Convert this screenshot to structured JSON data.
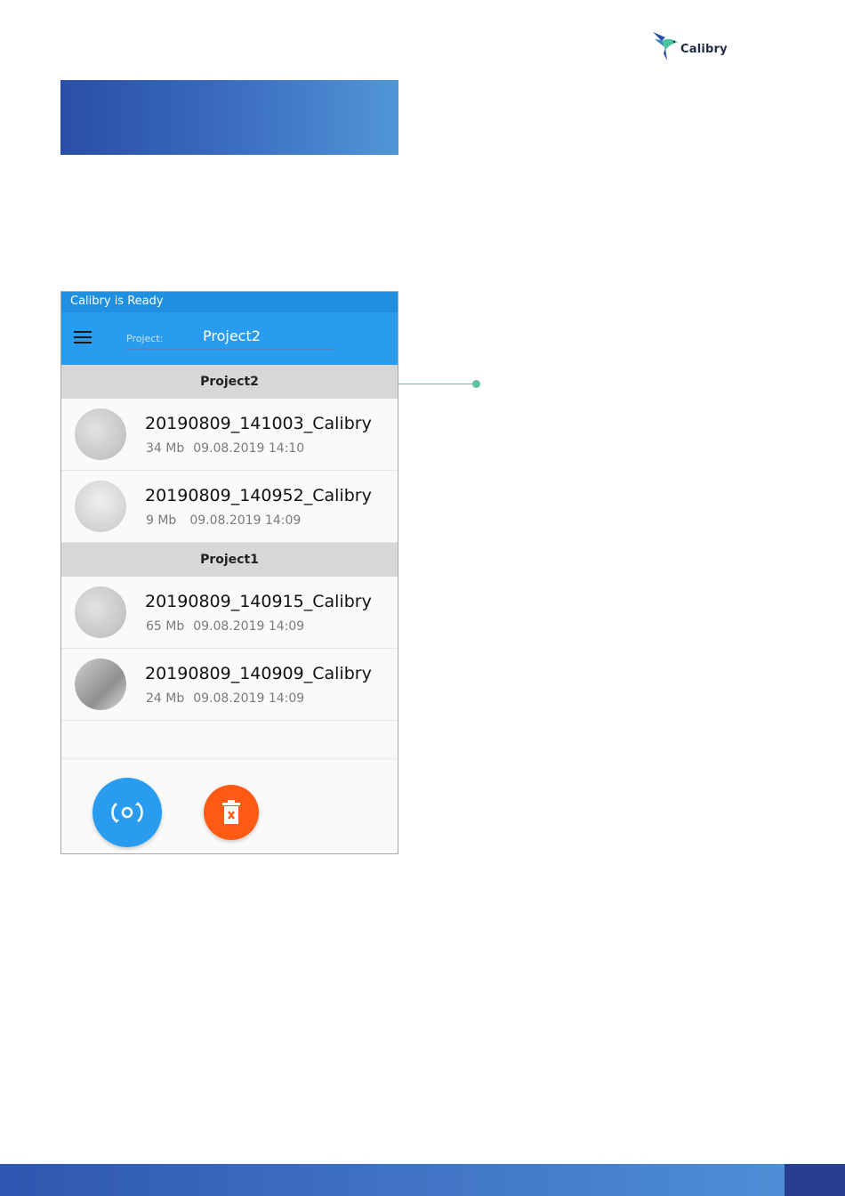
{
  "brand": {
    "logo_text": "Calibry"
  },
  "app": {
    "status_text": "Calibry is Ready",
    "project_label": "Project:",
    "project_value": "Project2"
  },
  "sections": [
    {
      "title": "Project2",
      "items": [
        {
          "name": "20190809_141003_Calibry",
          "size": "34 Mb",
          "date": "09.08.2019 14:10"
        },
        {
          "name": "20190809_140952_Calibry",
          "size": "9 Mb",
          "date": "09.08.2019 14:09"
        }
      ]
    },
    {
      "title": "Project1",
      "items": [
        {
          "name": "20190809_140915_Calibry",
          "size": "65 Mb",
          "date": "09.08.2019 14:09"
        },
        {
          "name": "20190809_140909_Calibry",
          "size": "24 Mb",
          "date": "09.08.2019 14:09"
        }
      ]
    }
  ],
  "icons": {
    "menu": "hamburger-menu-icon",
    "capture": "capture-icon",
    "delete": "trash-icon",
    "logo": "hummingbird-logo-icon"
  },
  "colors": {
    "appbar": "#2a9cf0",
    "statusbar": "#1f8fe0",
    "delete": "#ff5b14",
    "callout": "#5fc3a2",
    "banner_start": "#2a4ea8",
    "banner_end": "#5196d6"
  }
}
